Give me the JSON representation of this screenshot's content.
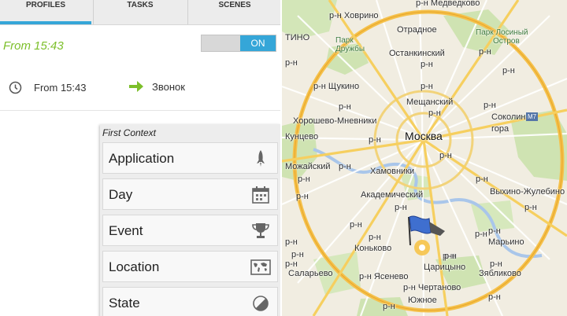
{
  "tabs": [
    {
      "label": "PROFILES",
      "active": true
    },
    {
      "label": "TASKS",
      "active": false
    },
    {
      "label": "SCENES",
      "active": false
    }
  ],
  "profile": {
    "title": "From 15:43",
    "toggle_label": "ON",
    "context_text": "From 15:43",
    "task_text": "Звонок"
  },
  "menu": {
    "title": "First Context",
    "items": [
      {
        "label": "Application",
        "icon": "rocket-icon"
      },
      {
        "label": "Day",
        "icon": "calendar-icon"
      },
      {
        "label": "Event",
        "icon": "trophy-icon"
      },
      {
        "label": "Location",
        "icon": "world-map-icon"
      },
      {
        "label": "State",
        "icon": "half-circle-icon"
      }
    ]
  },
  "map": {
    "labels": {
      "medvedkovo": "р-н Медведково",
      "khovrino": "р-н Ховрино",
      "otradnoe": "Отрадное",
      "titino": "ТИНО",
      "park_druzhby": "Парк Дружбы",
      "ostankinsky": "Останкинский",
      "rn_ostank": "р-н",
      "ussr_park": "Лосиный остров",
      "park_losiny": "Парк Лосиный",
      "ostrov": "Остров",
      "rn_topright": "р-н",
      "rn_right": "р-н",
      "rn_left1": "р-н",
      "shchukino": "р-н Щукино",
      "rn_mid1": "р-н",
      "rn_mid2": "р-н",
      "meshchansky": "Мещанский",
      "rn_mesh": "р-н",
      "rn_sokol": "р-н",
      "sokolnaya": "Соколиная",
      "gora": "гора",
      "khoroshevo": "Хорошево-Мневники",
      "kuntsevo": "Кунцево",
      "moskva": "Москва",
      "rn_m1": "р-н",
      "rn_m2": "р-н",
      "mozhaysky": "Можайский",
      "khamovniki": "Хамовники",
      "rn_khamov": "р-н",
      "rn_left2": "р-н",
      "akademichesky": "Академический",
      "rn_akad": "р-н",
      "rn_right2": "р-н",
      "vykhino": "Выхино-Жулебино",
      "rn_right3": "р-н",
      "rn_center": "р-н",
      "rn_center2": "р-н",
      "rn_lefts": "р-н",
      "konkovo": "Коньково",
      "rn_konkovo": "р-н",
      "rn_s1": "р-н",
      "rn_s2": "р-н",
      "rn_mar": "р-н",
      "maryino": "Марьино",
      "rn_left3": "р-н",
      "tsaritsyno": "Царицыно",
      "rn_tsar": "р-н",
      "zyablikovo": "Зябликово",
      "rn_zyab": "р-н",
      "yasenevo": "р-н Ясенево",
      "salaryevo": "Саларьево",
      "chertanovo": "р-н Чертаново",
      "yuzhnoe": "Южное",
      "rn_bottom": "р-н",
      "rn_br": "р-н",
      "rn_leftpark": "р-н",
      "m7": "M7"
    }
  },
  "colors": {
    "accent": "#35a6d8",
    "profile_green": "#7cbf2a",
    "ring_road": "#f5c14b",
    "park": "#cfe3b2",
    "water": "#a9c6ea"
  }
}
